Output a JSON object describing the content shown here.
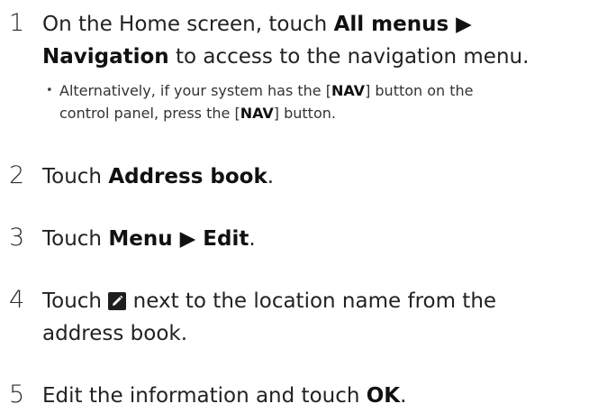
{
  "steps": [
    {
      "num": "1",
      "line1_pre": "On the Home screen, touch ",
      "line1_bold": "All menus ▶",
      "line2_bold": "Navigation",
      "line2_post": " to access to the navigation menu.",
      "note": {
        "bullet": "•",
        "pre": "Alternatively, if your system has the [",
        "bold1": "NAV",
        "mid": "] button on the",
        "line2_pre": "control panel, press the [",
        "bold2": "NAV",
        "post": "] button."
      }
    },
    {
      "num": "2",
      "pre": "Touch ",
      "bold": "Address book",
      "post": "."
    },
    {
      "num": "3",
      "pre": "Touch ",
      "bold": "Menu ▶ Edit",
      "post": "."
    },
    {
      "num": "4",
      "pre": "Touch ",
      "icon": "edit-pencil-icon",
      "post": " next to the location name from the",
      "line2": "address book."
    },
    {
      "num": "5",
      "pre": "Edit the information and touch ",
      "bold": "OK",
      "post": "."
    }
  ]
}
